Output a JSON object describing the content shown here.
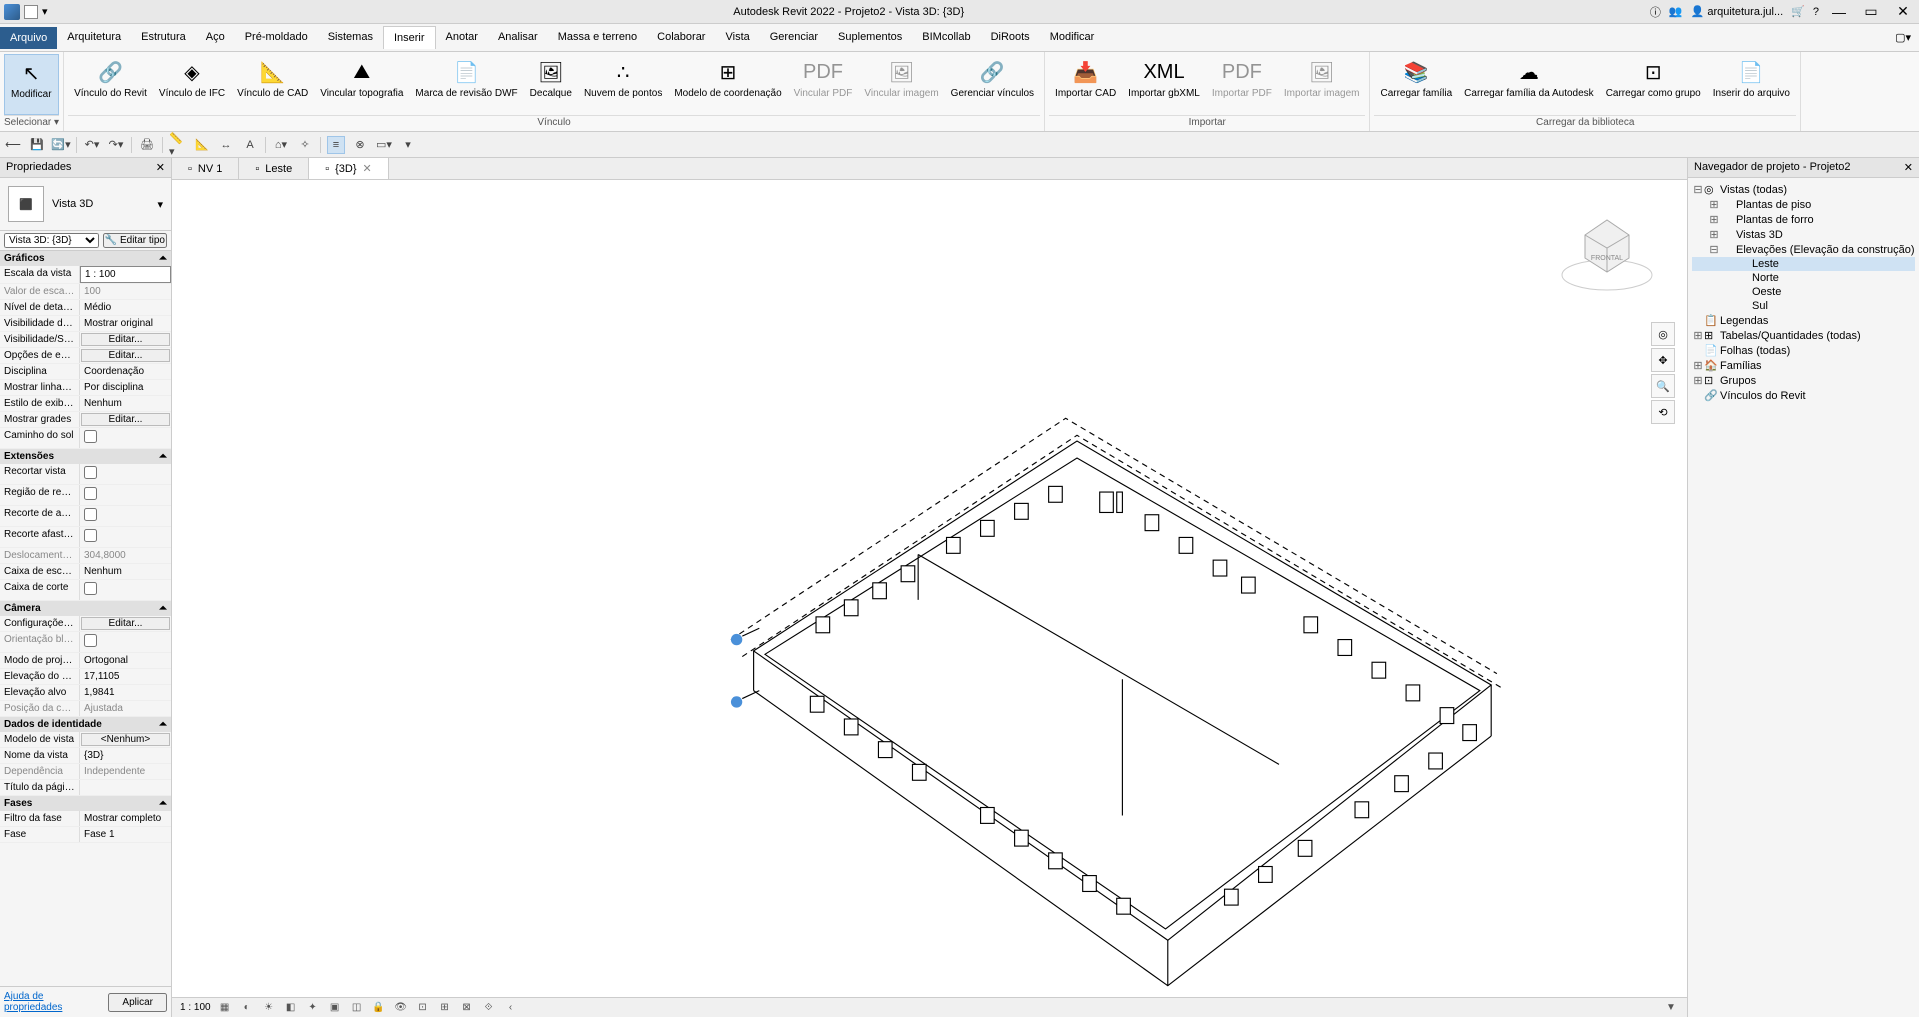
{
  "title": "Autodesk Revit 2022 - Projeto2 - Vista 3D: {3D}",
  "user": "arquitetura.jul...",
  "menu": {
    "file": "Arquivo",
    "tabs": [
      "Arquitetura",
      "Estrutura",
      "Aço",
      "Pré-moldado",
      "Sistemas",
      "Inserir",
      "Anotar",
      "Analisar",
      "Massa e terreno",
      "Colaborar",
      "Vista",
      "Gerenciar",
      "Suplementos",
      "BIMcollab",
      "DiRoots",
      "Modificar"
    ],
    "active": "Inserir"
  },
  "ribbon": {
    "modify": "Modificar",
    "select": "Selecionar",
    "groups": [
      {
        "label": "Vínculo",
        "items": [
          {
            "l": "Vínculo do\nRevit",
            "ic": "🔗"
          },
          {
            "l": "Vínculo de\nIFC",
            "ic": "◈"
          },
          {
            "l": "Vínculo de\nCAD",
            "ic": "📐"
          },
          {
            "l": "Vincular\ntopografia",
            "ic": "⛰"
          },
          {
            "l": "Marca de revisão\nDWF",
            "ic": "📄"
          },
          {
            "l": "Decalque",
            "ic": "🖼"
          },
          {
            "l": "Nuvem\nde pontos",
            "ic": "∴"
          },
          {
            "l": "Modelo de\ncoordenação",
            "ic": "⊞"
          },
          {
            "l": "Vincular\nPDF",
            "ic": "PDF",
            "d": true
          },
          {
            "l": "Vincular\nimagem",
            "ic": "🖼",
            "d": true
          },
          {
            "l": "Gerenciar\nvínculos",
            "ic": "🔗"
          }
        ]
      },
      {
        "label": "Importar",
        "items": [
          {
            "l": "Importar\nCAD",
            "ic": "📥"
          },
          {
            "l": "Importar\ngbXML",
            "ic": "XML"
          },
          {
            "l": "Importar\nPDF",
            "ic": "PDF",
            "d": true
          },
          {
            "l": "Importar\nimagem",
            "ic": "🖼",
            "d": true
          }
        ]
      },
      {
        "label": "Carregar da biblioteca",
        "items": [
          {
            "l": "Carregar\nfamília",
            "ic": "📚"
          },
          {
            "l": "Carregar família\nda Autodesk",
            "ic": "☁"
          },
          {
            "l": "Carregar como\ngrupo",
            "ic": "⊡"
          },
          {
            "l": "Inserir\ndo arquivo",
            "ic": "📄"
          }
        ]
      }
    ]
  },
  "view_tabs": [
    {
      "label": "NV 1"
    },
    {
      "label": "Leste"
    },
    {
      "label": "{3D}",
      "active": true,
      "close": true
    }
  ],
  "props": {
    "title": "Propriedades",
    "type": "Vista 3D",
    "instance_filter": "Vista 3D: {3D}",
    "edit_type": "Editar tipo",
    "cats": [
      {
        "name": "Gráficos",
        "rows": [
          {
            "k": "Escala da vista",
            "v": "1 : 100",
            "inp": true
          },
          {
            "k": "Valor de escala ...",
            "v": "100",
            "dim": true
          },
          {
            "k": "Nível de detalhe",
            "v": "Médio"
          },
          {
            "k": "Visibilidade de ...",
            "v": "Mostrar original"
          },
          {
            "k": "Visibilidade/So...",
            "v": "Editar...",
            "btn": true
          },
          {
            "k": "Opções de exibi...",
            "v": "Editar...",
            "btn": true
          },
          {
            "k": "Disciplina",
            "v": "Coordenação"
          },
          {
            "k": "Mostrar linhas ...",
            "v": "Por disciplina"
          },
          {
            "k": "Estilo de exibiçã...",
            "v": "Nenhum"
          },
          {
            "k": "Mostrar grades",
            "v": "Editar...",
            "btn": true
          },
          {
            "k": "Caminho do sol",
            "v": "",
            "cb": true
          }
        ]
      },
      {
        "name": "Extensões",
        "rows": [
          {
            "k": "Recortar vista",
            "v": "",
            "cb": true
          },
          {
            "k": "Região de recor...",
            "v": "",
            "cb": true
          },
          {
            "k": "Recorte de anot...",
            "v": "",
            "cb": true
          },
          {
            "k": "Recorte afastad...",
            "v": "",
            "cb": true
          },
          {
            "k": "Deslocamento ...",
            "v": "304,8000",
            "dim": true
          },
          {
            "k": "Caixa de escopo",
            "v": "Nenhum"
          },
          {
            "k": "Caixa de corte",
            "v": "",
            "cb": true
          }
        ]
      },
      {
        "name": "Câmera",
        "rows": [
          {
            "k": "Configurações ...",
            "v": "Editar...",
            "btn": true
          },
          {
            "k": "Orientação blo...",
            "v": "",
            "cb": true,
            "dim": true
          },
          {
            "k": "Modo de projeç...",
            "v": "Ortogonal"
          },
          {
            "k": "Elevação do olho",
            "v": "17,1105"
          },
          {
            "k": "Elevação alvo",
            "v": "1,9841"
          },
          {
            "k": "Posição da câm...",
            "v": "Ajustada",
            "dim": true
          }
        ]
      },
      {
        "name": "Dados de identidade",
        "rows": [
          {
            "k": "Modelo de vista",
            "v": "<Nenhum>",
            "btn": true
          },
          {
            "k": "Nome da vista",
            "v": "{3D}"
          },
          {
            "k": "Dependência",
            "v": "Independente",
            "dim": true
          },
          {
            "k": "Título da página",
            "v": ""
          }
        ]
      },
      {
        "name": "Fases",
        "rows": [
          {
            "k": "Filtro da fase",
            "v": "Mostrar completo"
          },
          {
            "k": "Fase",
            "v": "Fase 1"
          }
        ]
      }
    ],
    "help": "Ajuda de propriedades",
    "apply": "Aplicar"
  },
  "browser": {
    "title": "Navegador de projeto - Projeto2",
    "tree": [
      {
        "l": "Vistas (todas)",
        "d": 0,
        "exp": "-",
        "ic": "◎"
      },
      {
        "l": "Plantas de piso",
        "d": 1,
        "exp": "+"
      },
      {
        "l": "Plantas de forro",
        "d": 1,
        "exp": "+"
      },
      {
        "l": "Vistas 3D",
        "d": 1,
        "exp": "+"
      },
      {
        "l": "Elevações (Elevação da construção)",
        "d": 1,
        "exp": "-"
      },
      {
        "l": "Leste",
        "d": 2,
        "sel": true
      },
      {
        "l": "Norte",
        "d": 2
      },
      {
        "l": "Oeste",
        "d": 2
      },
      {
        "l": "Sul",
        "d": 2
      },
      {
        "l": "Legendas",
        "d": 0,
        "ic": "📋"
      },
      {
        "l": "Tabelas/Quantidades (todas)",
        "d": 0,
        "exp": "+",
        "ic": "⊞"
      },
      {
        "l": "Folhas (todas)",
        "d": 0,
        "ic": "📄"
      },
      {
        "l": "Famílias",
        "d": 0,
        "exp": "+",
        "ic": "🏠"
      },
      {
        "l": "Grupos",
        "d": 0,
        "exp": "+",
        "ic": "⊡"
      },
      {
        "l": "Vínculos do Revit",
        "d": 0,
        "ic": "🔗"
      }
    ]
  },
  "status": {
    "scale": "1 : 100"
  }
}
